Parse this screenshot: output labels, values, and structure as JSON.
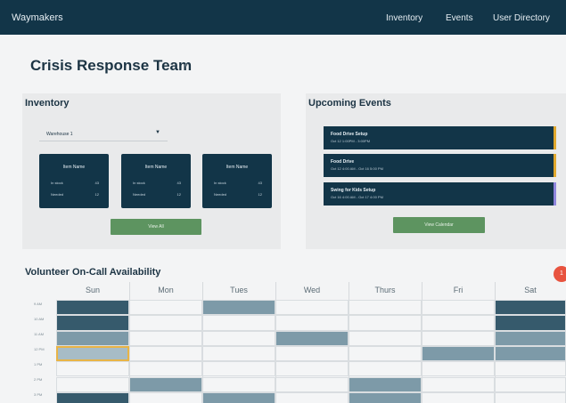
{
  "header": {
    "brand": "Waymakers",
    "nav": [
      "Inventory",
      "Events",
      "User Directory"
    ]
  },
  "team": {
    "title": "Crisis Response Team"
  },
  "inventory": {
    "heading": "Inventory",
    "warehouse": "Warehouse 1",
    "items": [
      {
        "name": "Item Name",
        "rows": [
          {
            "label": "In stock",
            "value": "43"
          },
          {
            "label": "Needed",
            "value": "12"
          }
        ]
      },
      {
        "name": "Item Name",
        "rows": [
          {
            "label": "In stock",
            "value": "43"
          },
          {
            "label": "Needed",
            "value": "12"
          }
        ]
      },
      {
        "name": "Item Name",
        "rows": [
          {
            "label": "In stock",
            "value": "43"
          },
          {
            "label": "Needed",
            "value": "12"
          }
        ]
      }
    ],
    "view_all": "View All"
  },
  "events": {
    "heading": "Upcoming Events",
    "items": [
      {
        "title": "Food Drive Setup",
        "time": "Oct 12 1:00PM - 3:00PM",
        "accent": "#e0a82e"
      },
      {
        "title": "Food Drive",
        "time": "Oct 12 4:00 AM - Oct 16 5:00 PM",
        "accent": "#e0a82e"
      },
      {
        "title": "Swing for Kids Setup",
        "time": "Oct 16 4:00 AM - Oct 17 4:00 PM",
        "accent": "#8f86dd"
      }
    ],
    "view_calendar": "View Calendar"
  },
  "availability": {
    "heading": "Volunteer On-Call Availability",
    "days": [
      "Sun",
      "Mon",
      "Tues",
      "Wed",
      "Thurs",
      "Fri",
      "Sat"
    ],
    "times": [
      "9 AM",
      "10 AM",
      "11 AM",
      "12 PM",
      "1 PM",
      "2 PM",
      "3 PM"
    ],
    "grid": [
      [
        3,
        0,
        2,
        0,
        0,
        0,
        3
      ],
      [
        3,
        0,
        0,
        0,
        0,
        0,
        3
      ],
      [
        2,
        0,
        0,
        2,
        0,
        0,
        2
      ],
      [
        1,
        0,
        0,
        0,
        0,
        2,
        2
      ],
      [
        0,
        0,
        0,
        0,
        0,
        0,
        0
      ],
      [
        0,
        2,
        0,
        0,
        2,
        0,
        0
      ],
      [
        3,
        0,
        2,
        0,
        2,
        0,
        0
      ]
    ],
    "selected_cell": {
      "row": 3,
      "col": 0
    },
    "levels": [
      "#f4f5f6",
      "#a7bcc6",
      "#7d9aa8",
      "#365a6c"
    ],
    "selected_color": "#e8b446"
  },
  "notifications": {
    "count": "1"
  }
}
